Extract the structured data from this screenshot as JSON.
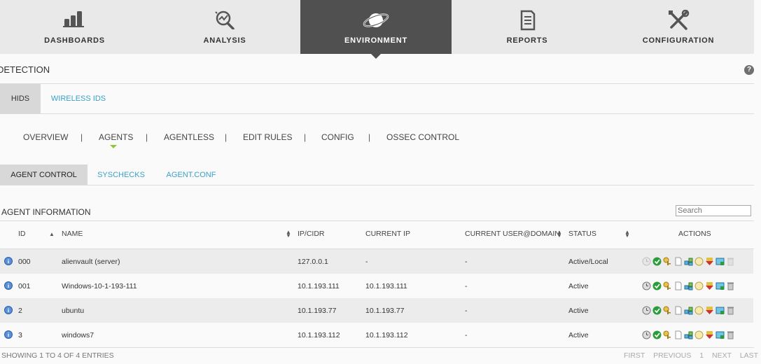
{
  "nav": {
    "tabs": [
      {
        "label": "DASHBOARDS",
        "icon": "bar-chart-icon",
        "active": false
      },
      {
        "label": "ANALYSIS",
        "icon": "magnifier-chart-icon",
        "active": false
      },
      {
        "label": "ENVIRONMENT",
        "icon": "planet-icon",
        "active": true
      },
      {
        "label": "REPORTS",
        "icon": "document-icon",
        "active": false
      },
      {
        "label": "CONFIGURATION",
        "icon": "tools-icon",
        "active": false
      }
    ]
  },
  "page": {
    "title": "DETECTION",
    "help": "?"
  },
  "subtabs": [
    {
      "label": "HIDS",
      "selected": true
    },
    {
      "label": "WIRELESS IDS",
      "selected": false
    }
  ],
  "menu": {
    "items": [
      "OVERVIEW",
      "AGENTS",
      "AGENTLESS",
      "EDIT RULES",
      "CONFIG",
      "OSSEC CONTROL"
    ],
    "separator": "|",
    "active": "AGENTS"
  },
  "controltabs": [
    {
      "label": "AGENT CONTROL",
      "selected": true
    },
    {
      "label": "SYSCHECKS",
      "selected": false
    },
    {
      "label": "AGENT.CONF",
      "selected": false
    }
  ],
  "section": {
    "title": "AGENT INFORMATION",
    "search_placeholder": "Search"
  },
  "table": {
    "headers": {
      "id": "ID",
      "name": "NAME",
      "ip": "IP/CIDR",
      "current_ip": "CURRENT IP",
      "user": "CURRENT USER@DOMAIN",
      "status": "STATUS",
      "actions": "ACTIONS"
    },
    "rows": [
      {
        "id": "000",
        "name": "alienvault (server)",
        "ip": "127.0.0.1",
        "current_ip": "-",
        "user": "-",
        "status": "Active/Local"
      },
      {
        "id": "001",
        "name": "Windows-10-1-193-111",
        "ip": "10.1.193.111",
        "current_ip": "10.1.193.111",
        "user": "-",
        "status": "Active"
      },
      {
        "id": "2",
        "name": "ubuntu",
        "ip": "10.1.193.77",
        "current_ip": "10.1.193.77",
        "user": "-",
        "status": "Active"
      },
      {
        "id": "3",
        "name": "windows7",
        "ip": "10.1.193.112",
        "current_ip": "10.1.193.112",
        "user": "-",
        "status": "Active"
      }
    ]
  },
  "footer": {
    "info": "SHOWING 1 TO 4 OF 4 ENTRIES",
    "first": "FIRST",
    "previous": "PREVIOUS",
    "page": "1",
    "next": "NEXT",
    "last": "LAST"
  },
  "colors": {
    "active_tab": "#505050",
    "link": "#3aa0c8",
    "accent_green": "#8dc63f"
  }
}
